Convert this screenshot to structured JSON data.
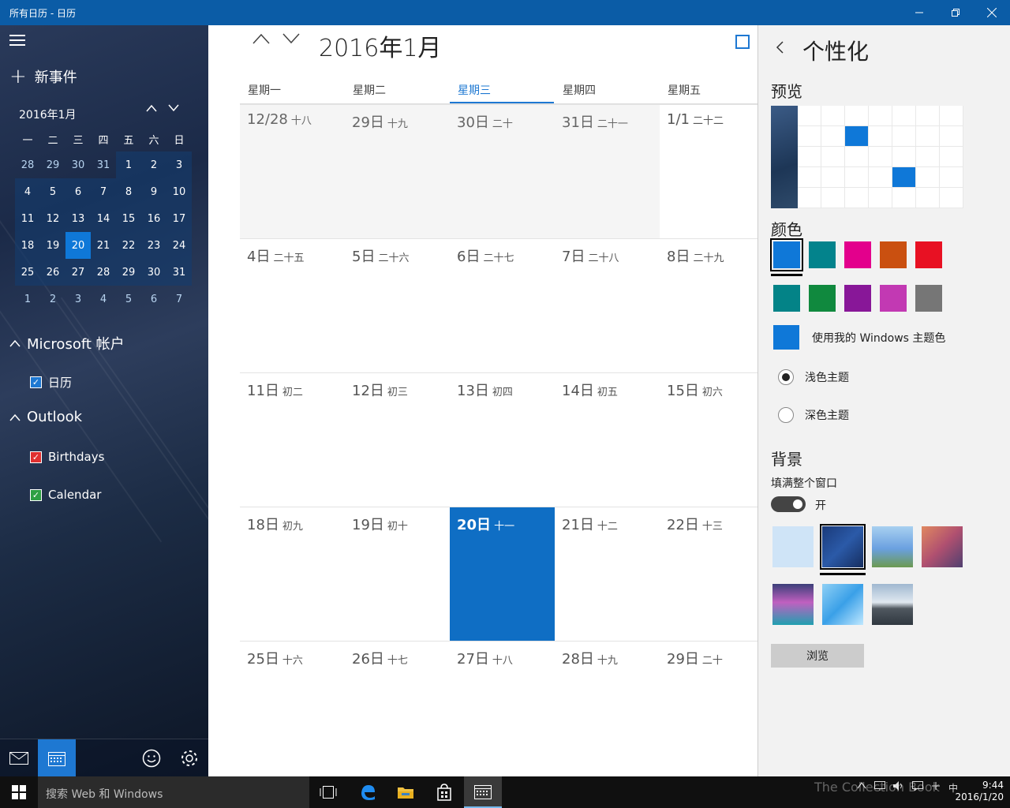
{
  "window": {
    "title": "所有日历 - 日历"
  },
  "sidebar": {
    "new_event": "新事件",
    "mini_month": "2016年1月",
    "weekdays": [
      "一",
      "二",
      "三",
      "四",
      "五",
      "六",
      "日"
    ],
    "weeks": [
      [
        "28",
        "29",
        "30",
        "31",
        "1",
        "2",
        "3"
      ],
      [
        "4",
        "5",
        "6",
        "7",
        "8",
        "9",
        "10"
      ],
      [
        "11",
        "12",
        "13",
        "14",
        "15",
        "16",
        "17"
      ],
      [
        "18",
        "19",
        "20",
        "21",
        "22",
        "23",
        "24"
      ],
      [
        "25",
        "26",
        "27",
        "28",
        "29",
        "30",
        "31"
      ],
      [
        "1",
        "2",
        "3",
        "4",
        "5",
        "6",
        "7"
      ]
    ],
    "today_value": "20",
    "accounts": [
      {
        "name": "Microsoft 帐户",
        "calendars": [
          {
            "label": "日历",
            "checked": true,
            "color": "#1e78d2"
          }
        ]
      },
      {
        "name": "Outlook",
        "calendars": [
          {
            "label": "Birthdays",
            "checked": true,
            "color": "#e03030"
          },
          {
            "label": "Calendar",
            "checked": true,
            "color": "#2ea043"
          }
        ]
      }
    ]
  },
  "main": {
    "month_title": "2016年1月",
    "weekdays": [
      "星期一",
      "星期二",
      "星期三",
      "星期四",
      "星期五"
    ],
    "selected_weekday": "星期三",
    "rows": [
      [
        {
          "d": "12/28",
          "l": "十八"
        },
        {
          "d": "29日",
          "l": "十九"
        },
        {
          "d": "30日",
          "l": "二十"
        },
        {
          "d": "31日",
          "l": "二十一"
        },
        {
          "d": "1/1",
          "l": "二十二"
        }
      ],
      [
        {
          "d": "4日",
          "l": "二十五"
        },
        {
          "d": "5日",
          "l": "二十六"
        },
        {
          "d": "6日",
          "l": "二十七"
        },
        {
          "d": "7日",
          "l": "二十八"
        },
        {
          "d": "8日",
          "l": "二十九"
        }
      ],
      [
        {
          "d": "11日",
          "l": "初二"
        },
        {
          "d": "12日",
          "l": "初三"
        },
        {
          "d": "13日",
          "l": "初四"
        },
        {
          "d": "14日",
          "l": "初五"
        },
        {
          "d": "15日",
          "l": "初六"
        }
      ],
      [
        {
          "d": "18日",
          "l": "初九"
        },
        {
          "d": "19日",
          "l": "初十"
        },
        {
          "d": "20日",
          "l": "十一"
        },
        {
          "d": "21日",
          "l": "十二"
        },
        {
          "d": "22日",
          "l": "十三"
        }
      ],
      [
        {
          "d": "25日",
          "l": "十六"
        },
        {
          "d": "26日",
          "l": "十七"
        },
        {
          "d": "27日",
          "l": "十八"
        },
        {
          "d": "28日",
          "l": "十九"
        },
        {
          "d": "29日",
          "l": "二十"
        }
      ]
    ]
  },
  "panel": {
    "title": "个性化",
    "preview_label": "预览",
    "color_label": "颜色",
    "colors_row1": [
      "#0f78d8",
      "#03838c",
      "#e3008c",
      "#ca5010",
      "#e81123"
    ],
    "colors_row2": [
      "#038387",
      "#10893e",
      "#881798",
      "#c239b3",
      "#767676"
    ],
    "use_theme_color": "使用我的 Windows 主题色",
    "light_theme": "浅色主题",
    "dark_theme": "深色主题",
    "background_label": "背景",
    "fill_window": "填满整个窗口",
    "toggle_state": "开",
    "browse": "浏览"
  },
  "taskbar": {
    "search_placeholder": "搜索 Web 和 Windows",
    "time": "9:44",
    "date": "2016/1/20",
    "ime": "中",
    "watermark": "The Collection Book"
  }
}
